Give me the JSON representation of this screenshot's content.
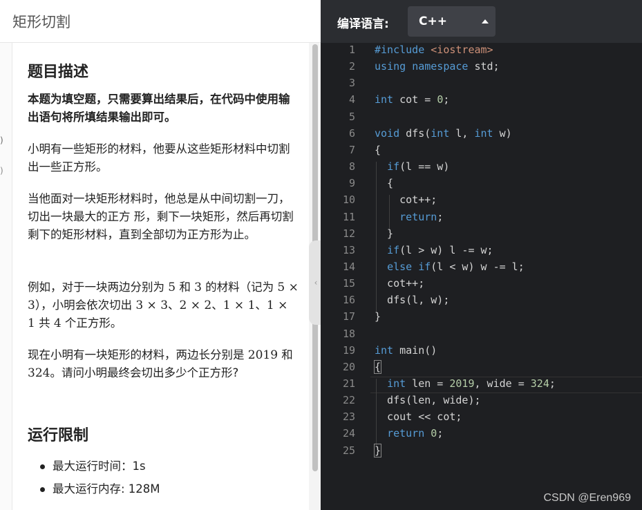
{
  "problem": {
    "title": "矩形切割",
    "description_heading": "题目描述",
    "bold_note": "本题为填空题，只需要算出结果后，在代码中使用输出语句将所填结果输出即可。",
    "para1": "小明有一些矩形的材料，他要从这些矩形材料中切割出一些正方形。",
    "para2": "当他面对一块矩形材料时，他总是从中间切割一刀，切出一块最大的正方 形，剩下一块矩形，然后再切割剩下的矩形材料，直到全部切为正方形为止。",
    "para3_a": "例如，对于一块两边分别为 ",
    "para3_m1": "5",
    "para3_b": " 和 ",
    "para3_m2": "3",
    "para3_c": " 的材料（记为 ",
    "para3_m3": "5 × 3",
    "para3_d": "），小明会依次切出 ",
    "para3_m4": "3 × 3",
    "para3_e": "、",
    "para3_m5": "2 × 2",
    "para3_f": "、",
    "para3_m6": "1 × 1",
    "para3_g": "、",
    "para3_m7": "1 × 1",
    "para3_h": " 共 ",
    "para3_m8": "4",
    "para3_i": " 个正方形。",
    "para4_a": "现在小明有一块矩形的材料，两边长分别是 ",
    "para4_m1": "2019",
    "para4_b": " 和 ",
    "para4_m2": "324",
    "para4_c": "。请问小明最终会切出多少个正方形?",
    "limits_heading": "运行限制",
    "limits": [
      "最大运行时间：1s",
      "最大运行内存: 128M"
    ],
    "gutter_marks": [
      ")",
      ")"
    ]
  },
  "editor": {
    "language_label": "编译语言:",
    "language_value": "C++",
    "line_numbers": [
      "1",
      "2",
      "3",
      "4",
      "5",
      "6",
      "7",
      "8",
      "9",
      "10",
      "11",
      "12",
      "13",
      "14",
      "15",
      "16",
      "17",
      "18",
      "19",
      "20",
      "21",
      "22",
      "23",
      "24",
      "25"
    ],
    "code": [
      "#include <iostream>",
      "using namespace std;",
      "",
      "int cot = 0;",
      "",
      "void dfs(int l, int w)",
      "{",
      "  if(l == w)",
      "  {",
      "    cot++;",
      "    return;",
      "  }",
      "  if(l > w) l -= w;",
      "  else if(l < w) w -= l;",
      "  cot++;",
      "  dfs(l, w);",
      "}",
      "",
      "int main()",
      "{",
      "  int len = 2019, wide = 324;",
      "  dfs(len, wide);",
      "  cout << cot;",
      "  return 0;",
      "}"
    ]
  },
  "watermark": "CSDN @Eren969",
  "colors": {
    "keyword": "#569cd6",
    "number": "#b5cea8",
    "string": "#ce9178",
    "editor_bg": "#1e1f22"
  }
}
